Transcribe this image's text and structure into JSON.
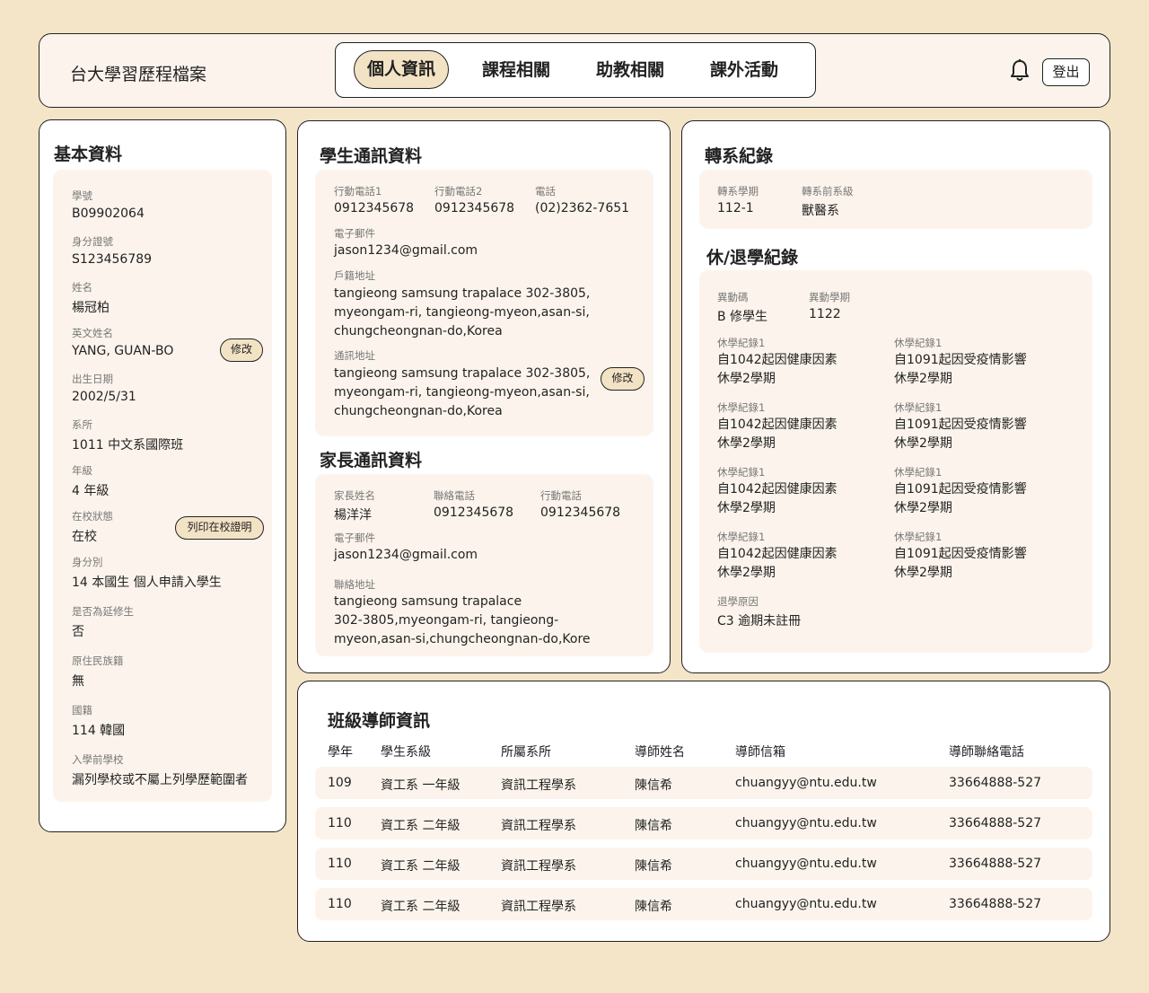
{
  "header": {
    "app_title": "台大學習歷程檔案",
    "tabs": [
      {
        "label": "個人資訊",
        "active": true
      },
      {
        "label": "課程相關",
        "active": false
      },
      {
        "label": "助教相關",
        "active": false
      },
      {
        "label": "課外活動",
        "active": false
      }
    ],
    "logout_label": "登出"
  },
  "basic": {
    "title": "基本資料",
    "edit_label": "修改",
    "print_label": "列印在校證明",
    "fields": [
      {
        "label": "學號",
        "value": "B09902064"
      },
      {
        "label": "身分證號",
        "value": "S123456789"
      },
      {
        "label": "姓名",
        "value": "楊冠柏"
      },
      {
        "label": "英文姓名",
        "value": "YANG, GUAN-BO"
      },
      {
        "label": "出生日期",
        "value": "2002/5/31"
      },
      {
        "label": "系所",
        "value": "1011 中文系國際班"
      },
      {
        "label": "年級",
        "value": "4 年級"
      },
      {
        "label": "在校狀態",
        "value": "在校"
      },
      {
        "label": "身分別",
        "value": "14  本國生  個人申請入學生"
      },
      {
        "label": "是否為延修生",
        "value": "否"
      },
      {
        "label": "原住民族籍",
        "value": "無"
      },
      {
        "label": "國籍",
        "value": "114 韓國"
      },
      {
        "label": "入學前學校",
        "value": "漏列學校或不屬上列學歷範圍者"
      }
    ]
  },
  "student_contact": {
    "title": "學生通訊資料",
    "edit_label": "修改",
    "mobile1_label": "行動電話1",
    "mobile1": "0912345678",
    "mobile2_label": "行動電話2",
    "mobile2": "0912345678",
    "phone_label": "電話",
    "phone": "(02)2362-7651",
    "email_label": "電子郵件",
    "email": "jason1234@gmail.com",
    "household_label": "戶籍地址",
    "household_lines": [
      "tangieong samsung trapalace 302-3805,",
      "myeongam-ri, tangieong-myeon,asan-si,",
      "chungcheongnan-do,Korea"
    ],
    "mailing_label": "通訊地址",
    "mailing_lines": [
      "tangieong samsung trapalace 302-3805,",
      "myeongam-ri, tangieong-myeon,asan-si,",
      "chungcheongnan-do,Korea"
    ]
  },
  "parent_contact": {
    "title": "家長通訊資料",
    "name_label": "家長姓名",
    "name": "楊洋洋",
    "phone_label": "聯絡電話",
    "phone": "0912345678",
    "mobile_label": "行動電話",
    "mobile": "0912345678",
    "email_label": "電子郵件",
    "email": "jason1234@gmail.com",
    "address_label": "聯絡地址",
    "address_lines": [
      "tangieong samsung trapalace",
      "302-3805,myeongam-ri, tangieong-",
      "myeon,asan-si,chungcheongnan-do,Kore"
    ]
  },
  "transfer": {
    "title": "轉系紀錄",
    "term_label": "轉系學期",
    "term": "112-1",
    "prev_label": "轉系前系級",
    "prev": "獸醫系"
  },
  "leave": {
    "title": "休/退學紀錄",
    "code_label": "異動碼",
    "code": "B 修學生",
    "term_label": "異動學期",
    "term": "1122",
    "records": [
      {
        "label": "休學紀錄1",
        "line1": "自1042起因健康因素",
        "line2": "休學2學期"
      },
      {
        "label": "休學紀錄1",
        "line1": "自1091起因受疫情影響",
        "line2": "休學2學期"
      },
      {
        "label": "休學紀錄1",
        "line1": "自1042起因健康因素",
        "line2": "休學2學期"
      },
      {
        "label": "休學紀錄1",
        "line1": "自1091起因受疫情影響",
        "line2": "休學2學期"
      },
      {
        "label": "休學紀錄1",
        "line1": "自1042起因健康因素",
        "line2": "休學2學期"
      },
      {
        "label": "休學紀錄1",
        "line1": "自1091起因受疫情影響",
        "line2": "休學2學期"
      },
      {
        "label": "休學紀錄1",
        "line1": "自1042起因健康因素",
        "line2": "休學2學期"
      },
      {
        "label": "休學紀錄1",
        "line1": "自1091起因受疫情影響",
        "line2": "休學2學期"
      }
    ],
    "withdraw_label": "退學原因",
    "withdraw": "C3 逾期未註冊"
  },
  "mentor": {
    "title": "班級導師資訊",
    "headers": [
      "學年",
      "學生系級",
      "所屬系所",
      "導師姓名",
      "導師信箱",
      "導師聯絡電話"
    ],
    "rows": [
      [
        "109",
        "資工系 一年級",
        "資訊工程學系",
        "陳信希",
        "chuangyy@ntu.edu.tw",
        "33664888-527"
      ],
      [
        "110",
        "資工系 二年級",
        "資訊工程學系",
        "陳信希",
        "chuangyy@ntu.edu.tw",
        "33664888-527"
      ],
      [
        "110",
        "資工系 二年級",
        "資訊工程學系",
        "陳信希",
        "chuangyy@ntu.edu.tw",
        "33664888-527"
      ],
      [
        "110",
        "資工系 二年級",
        "資訊工程學系",
        "陳信希",
        "chuangyy@ntu.edu.tw",
        "33664888-527"
      ]
    ]
  }
}
